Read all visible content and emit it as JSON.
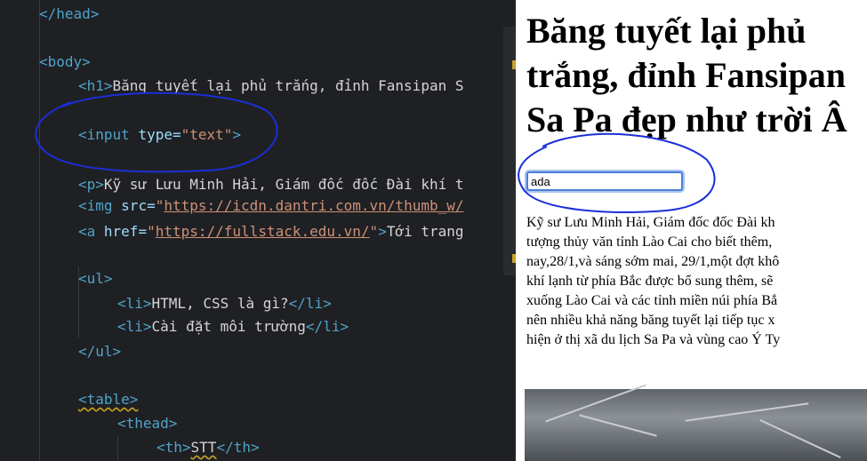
{
  "editor": {
    "lines": {
      "head_close": "</head>",
      "body_open": "<body>",
      "h1_open": "<h1>",
      "h1_text": "Băng tuyết lại phủ trắng, đỉnh Fansipan S",
      "input_open": "<input",
      "input_attr": "type=",
      "input_val": "\"text\"",
      "input_close": ">",
      "p_open": "<p>",
      "p_text": "Kỹ sư Lưu Minh Hải, Giám đốc đốc Đài khí t",
      "img_open": "<img",
      "img_attr": "src=",
      "img_q": "\"",
      "img_url": "https://icdn.dantri.com.vn/thumb_w/",
      "a_open": "<a",
      "a_attr": "href=",
      "a_q": "\"",
      "a_url": "https://fullstack.edu.vn/",
      "a_q2": "\"",
      "a_close": ">",
      "a_text": "Tới trang",
      "ul_open": "<ul>",
      "li1_open": "<li>",
      "li1_text": "HTML, CSS là gì?",
      "li1_close": "</li>",
      "li2_open": "<li>",
      "li2_text": "Cài đặt môi trường",
      "li2_close": "</li>",
      "ul_close": "</ul>",
      "table_open": "<table>",
      "thead_open": "<thead>",
      "th_open": "<th>",
      "th_text": "STT",
      "th_close": "</th>"
    }
  },
  "preview": {
    "heading": "Băng tuyết lại phủ\ntrắng, đỉnh Fansipan\nSa Pa đẹp như trời Â",
    "input_value": "ada",
    "paragraph": "Kỹ sư Lưu Minh Hải, Giám đốc đốc Đài kh\ntượng thủy văn tỉnh Lào Cai cho biết thêm,\nnay,28/1,và sáng sớm mai, 29/1,một đợt khô\nkhí lạnh từ phía Bắc được bổ sung thêm, sẽ\nxuống Lào Cai và các tỉnh miền núi phía Bắ\nnên nhiều khả năng băng tuyết lại tiếp tục x\nhiện ở thị xã du lịch Sa Pa và vùng cao Ý Ty"
  },
  "colors": {
    "annotation": "#1a2fd6",
    "tag": "#4fa3c9",
    "string": "#ce9178"
  }
}
